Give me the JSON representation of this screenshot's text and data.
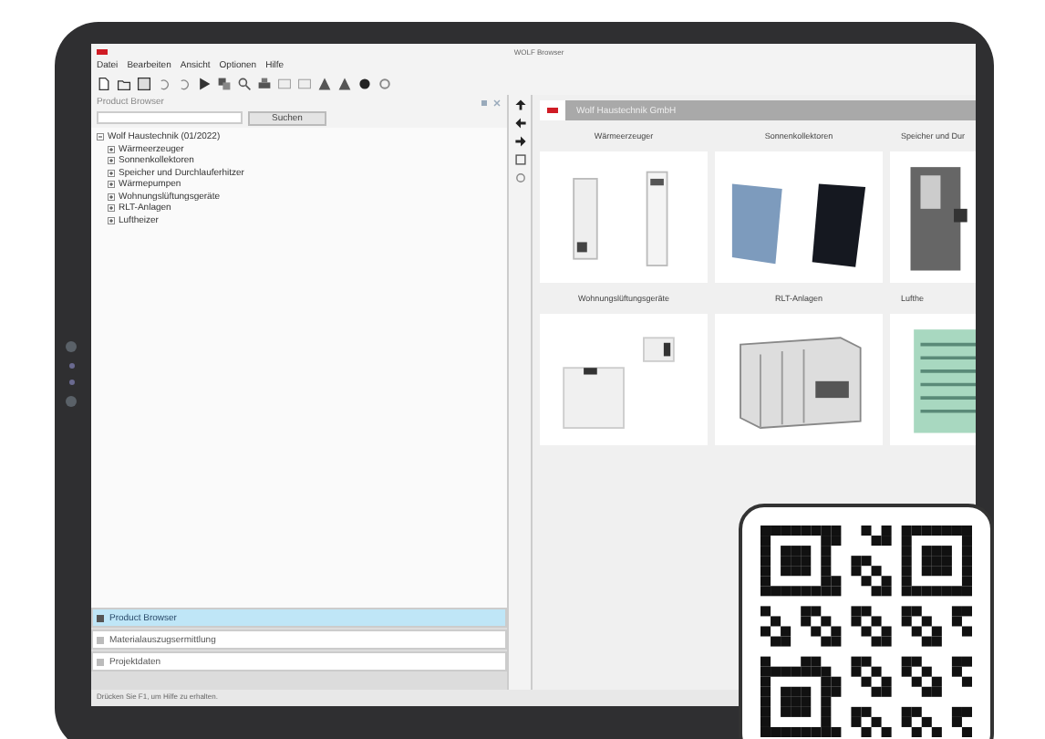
{
  "window": {
    "title": "WOLF Browser"
  },
  "menu": [
    "Datei",
    "Bearbeiten",
    "Ansicht",
    "Optionen",
    "Hilfe"
  ],
  "left_panel": {
    "title": "Product Browser",
    "search_button": "Suchen",
    "tree": [
      {
        "label": "Wolf Haustechnik (01/2022)",
        "expanded": true,
        "children": [
          {
            "label": "Wärmeerzeuger",
            "expanded": false
          },
          {
            "label": "Sonnenkollektoren",
            "expanded": false
          },
          {
            "label": "Speicher und Durchlauferhitzer",
            "expanded": false
          },
          {
            "label": "Wärmepumpen",
            "expanded": false
          },
          {
            "label": "Wohnungslüftungsgeräte",
            "expanded": false
          },
          {
            "label": "RLT-Anlagen",
            "expanded": false
          },
          {
            "label": "Luftheizer",
            "expanded": false
          }
        ]
      }
    ]
  },
  "bottom_tabs": [
    {
      "label": "Product Browser",
      "selected": true
    },
    {
      "label": "Materialauszugsermittlung",
      "selected": false
    },
    {
      "label": "Projektdaten",
      "selected": false
    }
  ],
  "catalog": {
    "header": "Wolf Haustechnik GmbH",
    "categories": [
      {
        "label": "Wärmeerzeuger",
        "kind": "boiler"
      },
      {
        "label": "Sonnenkollektoren",
        "kind": "solar"
      },
      {
        "label": "Speicher und Dur",
        "kind": "tank"
      },
      {
        "label": "Wohnungslüftungsgeräte",
        "kind": "ventilation"
      },
      {
        "label": "RLT-Anlagen",
        "kind": "airhandler"
      },
      {
        "label": "Lufthe",
        "kind": "heater"
      }
    ]
  },
  "status_bar": "Drücken Sie F1, um Hilfe zu erhalten."
}
